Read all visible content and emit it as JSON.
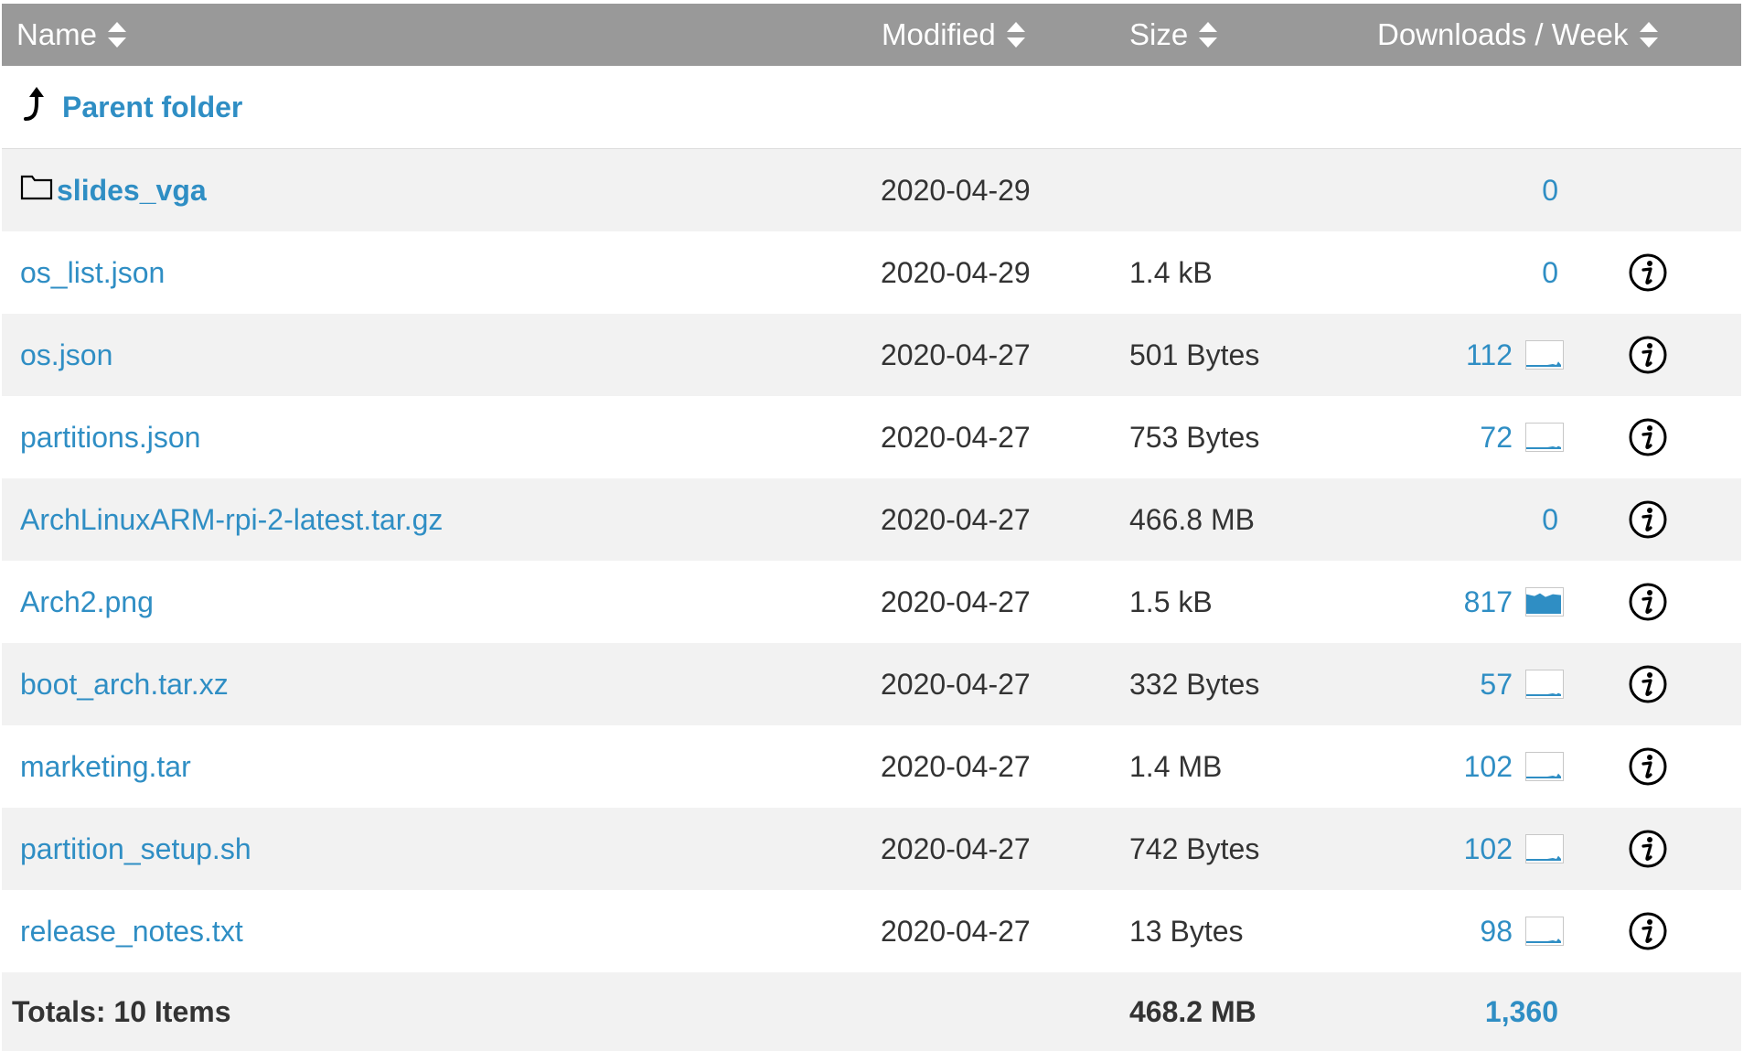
{
  "headers": {
    "name": "Name",
    "modified": "Modified",
    "size": "Size",
    "downloads": "Downloads / Week"
  },
  "parent": {
    "label": "Parent folder"
  },
  "rows": [
    {
      "name": "slides_vga",
      "type": "folder",
      "modified": "2020-04-29",
      "size": "",
      "downloads": "0",
      "spark": false,
      "info": false
    },
    {
      "name": "os_list.json",
      "type": "file",
      "modified": "2020-04-29",
      "size": "1.4 kB",
      "downloads": "0",
      "spark": false,
      "info": true
    },
    {
      "name": "os.json",
      "type": "file",
      "modified": "2020-04-27",
      "size": "501 Bytes",
      "downloads": "112",
      "spark": true,
      "spark_level": 0.2,
      "info": true
    },
    {
      "name": "partitions.json",
      "type": "file",
      "modified": "2020-04-27",
      "size": "753 Bytes",
      "downloads": "72",
      "spark": true,
      "spark_level": 0.1,
      "info": true
    },
    {
      "name": "ArchLinuxARM-rpi-2-latest.tar.gz",
      "type": "file",
      "modified": "2020-04-27",
      "size": "466.8 MB",
      "downloads": "0",
      "spark": false,
      "info": true
    },
    {
      "name": "Arch2.png",
      "type": "file",
      "modified": "2020-04-27",
      "size": "1.5 kB",
      "downloads": "817",
      "spark": true,
      "spark_level": 0.85,
      "info": true
    },
    {
      "name": "boot_arch.tar.xz",
      "type": "file",
      "modified": "2020-04-27",
      "size": "332 Bytes",
      "downloads": "57",
      "spark": true,
      "spark_level": 0.1,
      "info": true
    },
    {
      "name": "marketing.tar",
      "type": "file",
      "modified": "2020-04-27",
      "size": "1.4 MB",
      "downloads": "102",
      "spark": true,
      "spark_level": 0.18,
      "info": true
    },
    {
      "name": "partition_setup.sh",
      "type": "file",
      "modified": "2020-04-27",
      "size": "742 Bytes",
      "downloads": "102",
      "spark": true,
      "spark_level": 0.18,
      "info": true
    },
    {
      "name": "release_notes.txt",
      "type": "file",
      "modified": "2020-04-27",
      "size": "13 Bytes",
      "downloads": "98",
      "spark": true,
      "spark_level": 0.16,
      "info": true
    }
  ],
  "totals": {
    "label": "Totals: 10 Items",
    "size": "468.2 MB",
    "downloads": "1,360"
  },
  "colors": {
    "header_bg": "#999999",
    "link": "#2f8ec4",
    "row_alt": "#f2f2f2"
  }
}
